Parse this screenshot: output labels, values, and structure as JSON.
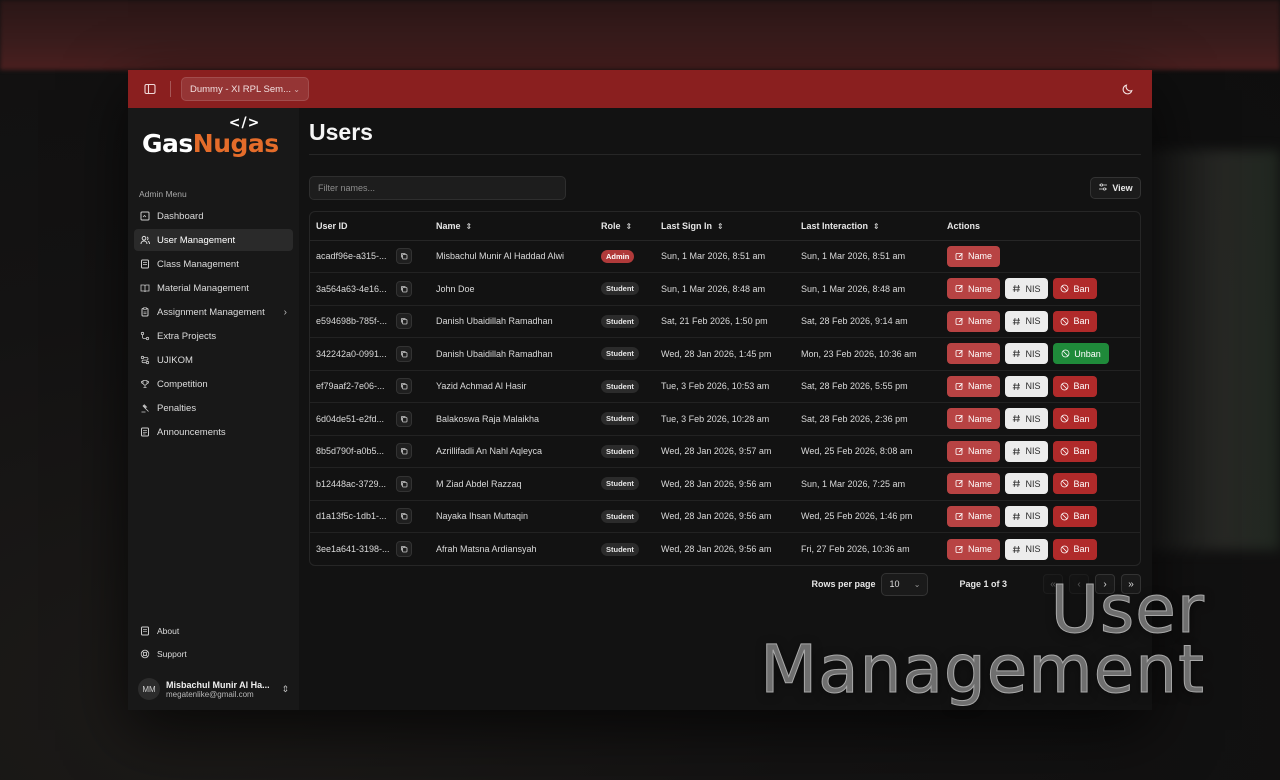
{
  "topbar": {
    "class_select": "Dummy - XI RPL Sem...",
    "theme_icon": "moon-icon"
  },
  "sidebar": {
    "logo_left": "Gas",
    "logo_right": "Nugas",
    "logo_mark": "</>",
    "menu_heading": "Admin Menu",
    "items": [
      {
        "label": "Dashboard",
        "icon": "dashboard-icon"
      },
      {
        "label": "User Management",
        "icon": "users-icon"
      },
      {
        "label": "Class Management",
        "icon": "class-icon"
      },
      {
        "label": "Material Management",
        "icon": "book-icon"
      },
      {
        "label": "Assignment Management",
        "icon": "clipboard-icon"
      },
      {
        "label": "Extra Projects",
        "icon": "git-icon"
      },
      {
        "label": "UJIKOM",
        "icon": "route-icon"
      },
      {
        "label": "Competition",
        "icon": "trophy-icon"
      },
      {
        "label": "Penalties",
        "icon": "gavel-icon"
      },
      {
        "label": "Announcements",
        "icon": "megaphone-icon"
      }
    ],
    "bottom_items": [
      {
        "label": "About",
        "icon": "info-icon"
      },
      {
        "label": "Support",
        "icon": "lifebuoy-icon"
      }
    ],
    "user": {
      "initials": "MM",
      "name": "Misbachul Munir Al Ha...",
      "email": "megatenlike@gmail.com"
    }
  },
  "main": {
    "title": "Users",
    "filter_placeholder": "Filter names...",
    "view_label": "View",
    "columns": [
      "User ID",
      "Name",
      "Role",
      "Last Sign In",
      "Last Interaction",
      "Actions"
    ],
    "rows": [
      {
        "id": "acadf96e-a315-...",
        "name": "Misbachul Munir Al Haddad Alwi",
        "role": "Admin",
        "sign_in": "Sun, 1 Mar 2026, 8:51 am",
        "interaction": "Sun, 1 Mar 2026, 8:51 am",
        "actions": "admin"
      },
      {
        "id": "3a564a63-4e16...",
        "name": "John Doe",
        "role": "Student",
        "sign_in": "Sun, 1 Mar 2026, 8:48 am",
        "interaction": "Sun, 1 Mar 2026, 8:48 am",
        "actions": "ban"
      },
      {
        "id": "e594698b-785f-...",
        "name": "Danish Ubaidillah Ramadhan",
        "role": "Student",
        "sign_in": "Sat, 21 Feb 2026, 1:50 pm",
        "interaction": "Sat, 28 Feb 2026, 9:14 am",
        "actions": "ban"
      },
      {
        "id": "342242a0-0991...",
        "name": "Danish Ubaidillah Ramadhan",
        "role": "Student",
        "sign_in": "Wed, 28 Jan 2026, 1:45 pm",
        "interaction": "Mon, 23 Feb 2026, 10:36 am",
        "actions": "unban"
      },
      {
        "id": "ef79aaf2-7e06-...",
        "name": "Yazid Achmad Al Hasir",
        "role": "Student",
        "sign_in": "Tue, 3 Feb 2026, 10:53 am",
        "interaction": "Sat, 28 Feb 2026, 5:55 pm",
        "actions": "ban"
      },
      {
        "id": "6d04de51-e2fd...",
        "name": "Balakoswa Raja Malaikha",
        "role": "Student",
        "sign_in": "Tue, 3 Feb 2026, 10:28 am",
        "interaction": "Sat, 28 Feb 2026, 2:36 pm",
        "actions": "ban"
      },
      {
        "id": "8b5d790f-a0b5...",
        "name": "Azrillifadli An Nahl Aqleyca",
        "role": "Student",
        "sign_in": "Wed, 28 Jan 2026, 9:57 am",
        "interaction": "Wed, 25 Feb 2026, 8:08 am",
        "actions": "ban"
      },
      {
        "id": "b12448ac-3729...",
        "name": "M Ziad Abdel Razzaq",
        "role": "Student",
        "sign_in": "Wed, 28 Jan 2026, 9:56 am",
        "interaction": "Sun, 1 Mar 2026, 7:25 am",
        "actions": "ban"
      },
      {
        "id": "d1a13f5c-1db1-...",
        "name": "Nayaka Ihsan Muttaqin",
        "role": "Student",
        "sign_in": "Wed, 28 Jan 2026, 9:56 am",
        "interaction": "Wed, 25 Feb 2026, 1:46 pm",
        "actions": "ban"
      },
      {
        "id": "3ee1a641-3198-...",
        "name": "Afrah Matsna Ardiansyah",
        "role": "Student",
        "sign_in": "Wed, 28 Jan 2026, 9:56 am",
        "interaction": "Fri, 27 Feb 2026, 10:36 am",
        "actions": "ban"
      }
    ],
    "action_labels": {
      "name": "Name",
      "nis": "NIS",
      "ban": "Ban",
      "unban": "Unban"
    },
    "pagination": {
      "rows_per_page_label": "Rows per page",
      "rows_per_page": "10",
      "page_info": "Page 1 of 3"
    }
  },
  "overlay": {
    "line1": "User",
    "line2": "Management"
  },
  "colors": {
    "topbar": "#8a1f1f",
    "accent_orange": "#e46c2a",
    "admin_badge": "#b03a3a",
    "ban": "#b02a2a",
    "unban": "#1f8a3a"
  }
}
